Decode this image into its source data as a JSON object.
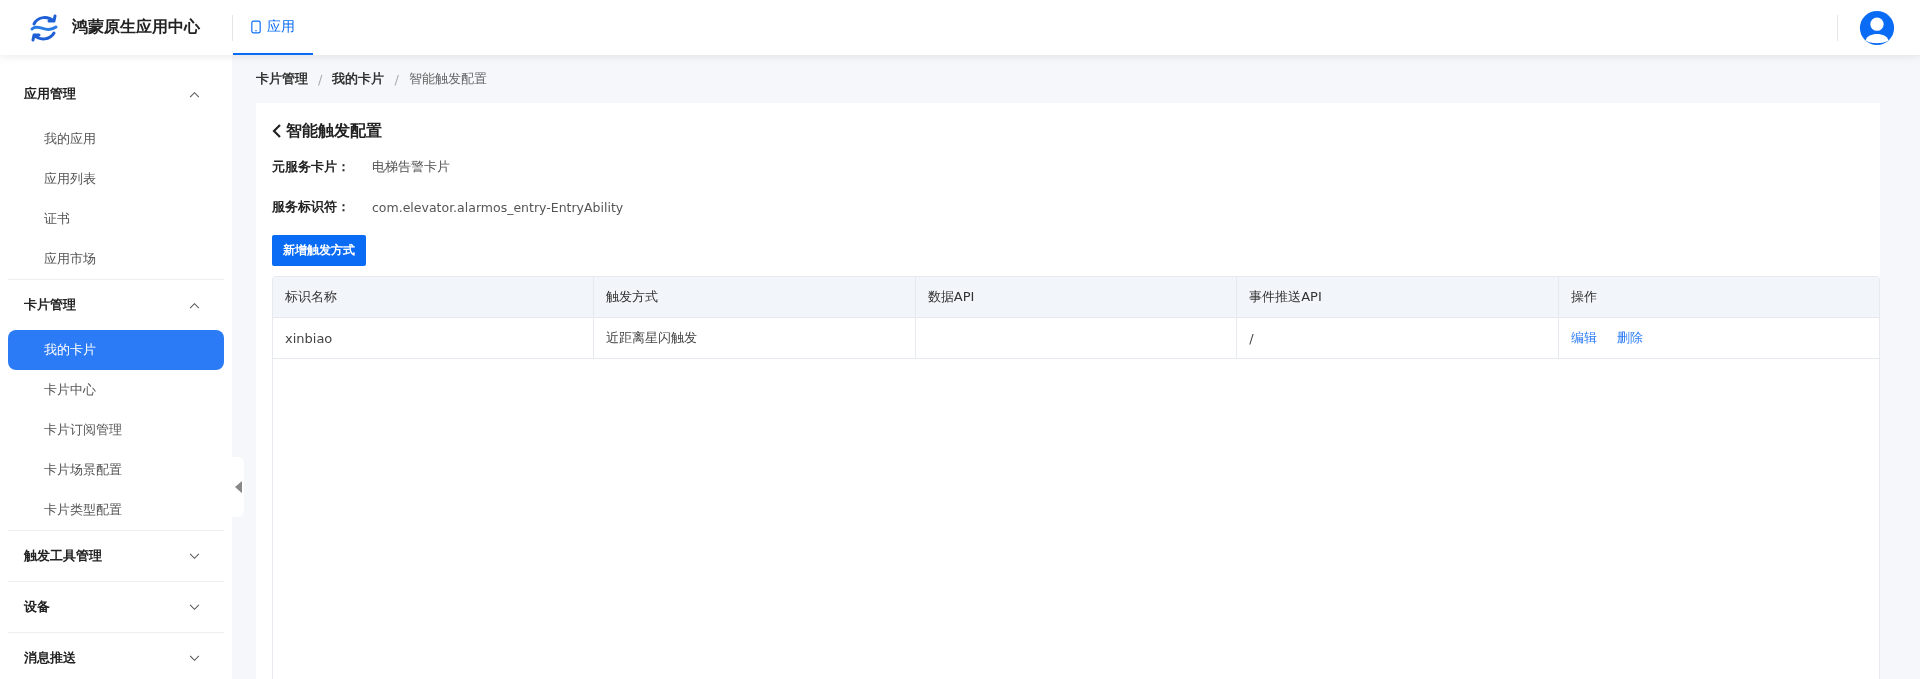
{
  "header": {
    "app_title": "鸿蒙原生应用中心",
    "tabs": [
      {
        "label": "应用",
        "selected": true
      }
    ]
  },
  "sidebar": {
    "groups": [
      {
        "label": "应用管理",
        "expanded": true,
        "items": [
          {
            "label": "我的应用",
            "selected": false
          },
          {
            "label": "应用列表",
            "selected": false
          },
          {
            "label": "证书",
            "selected": false
          },
          {
            "label": "应用市场",
            "selected": false
          }
        ]
      },
      {
        "label": "卡片管理",
        "expanded": true,
        "items": [
          {
            "label": "我的卡片",
            "selected": true
          },
          {
            "label": "卡片中心",
            "selected": false
          },
          {
            "label": "卡片订阅管理",
            "selected": false
          },
          {
            "label": "卡片场景配置",
            "selected": false
          },
          {
            "label": "卡片类型配置",
            "selected": false
          }
        ]
      },
      {
        "label": "触发工具管理",
        "expanded": false
      },
      {
        "label": "设备",
        "expanded": false
      },
      {
        "label": "消息推送",
        "expanded": false
      }
    ]
  },
  "breadcrumb": {
    "separator": "/",
    "items": [
      "卡片管理",
      "我的卡片",
      "智能触发配置"
    ]
  },
  "page_title": "智能触发配置",
  "fields": [
    {
      "label": "元服务卡片：",
      "value": "电梯告警卡片"
    },
    {
      "label": "服务标识符：",
      "value": "com.elevator.alarmos_entry-EntryAbility"
    }
  ],
  "add_button": "新增触发方式",
  "table": {
    "columns": [
      "标识名称",
      "触发方式",
      "数据API",
      "事件推送API",
      "操作"
    ],
    "rows": [
      {
        "cells": [
          "xinbiao",
          "近距离星闪触发",
          "",
          "/"
        ],
        "actions": [
          "编辑",
          "删除"
        ]
      }
    ]
  }
}
